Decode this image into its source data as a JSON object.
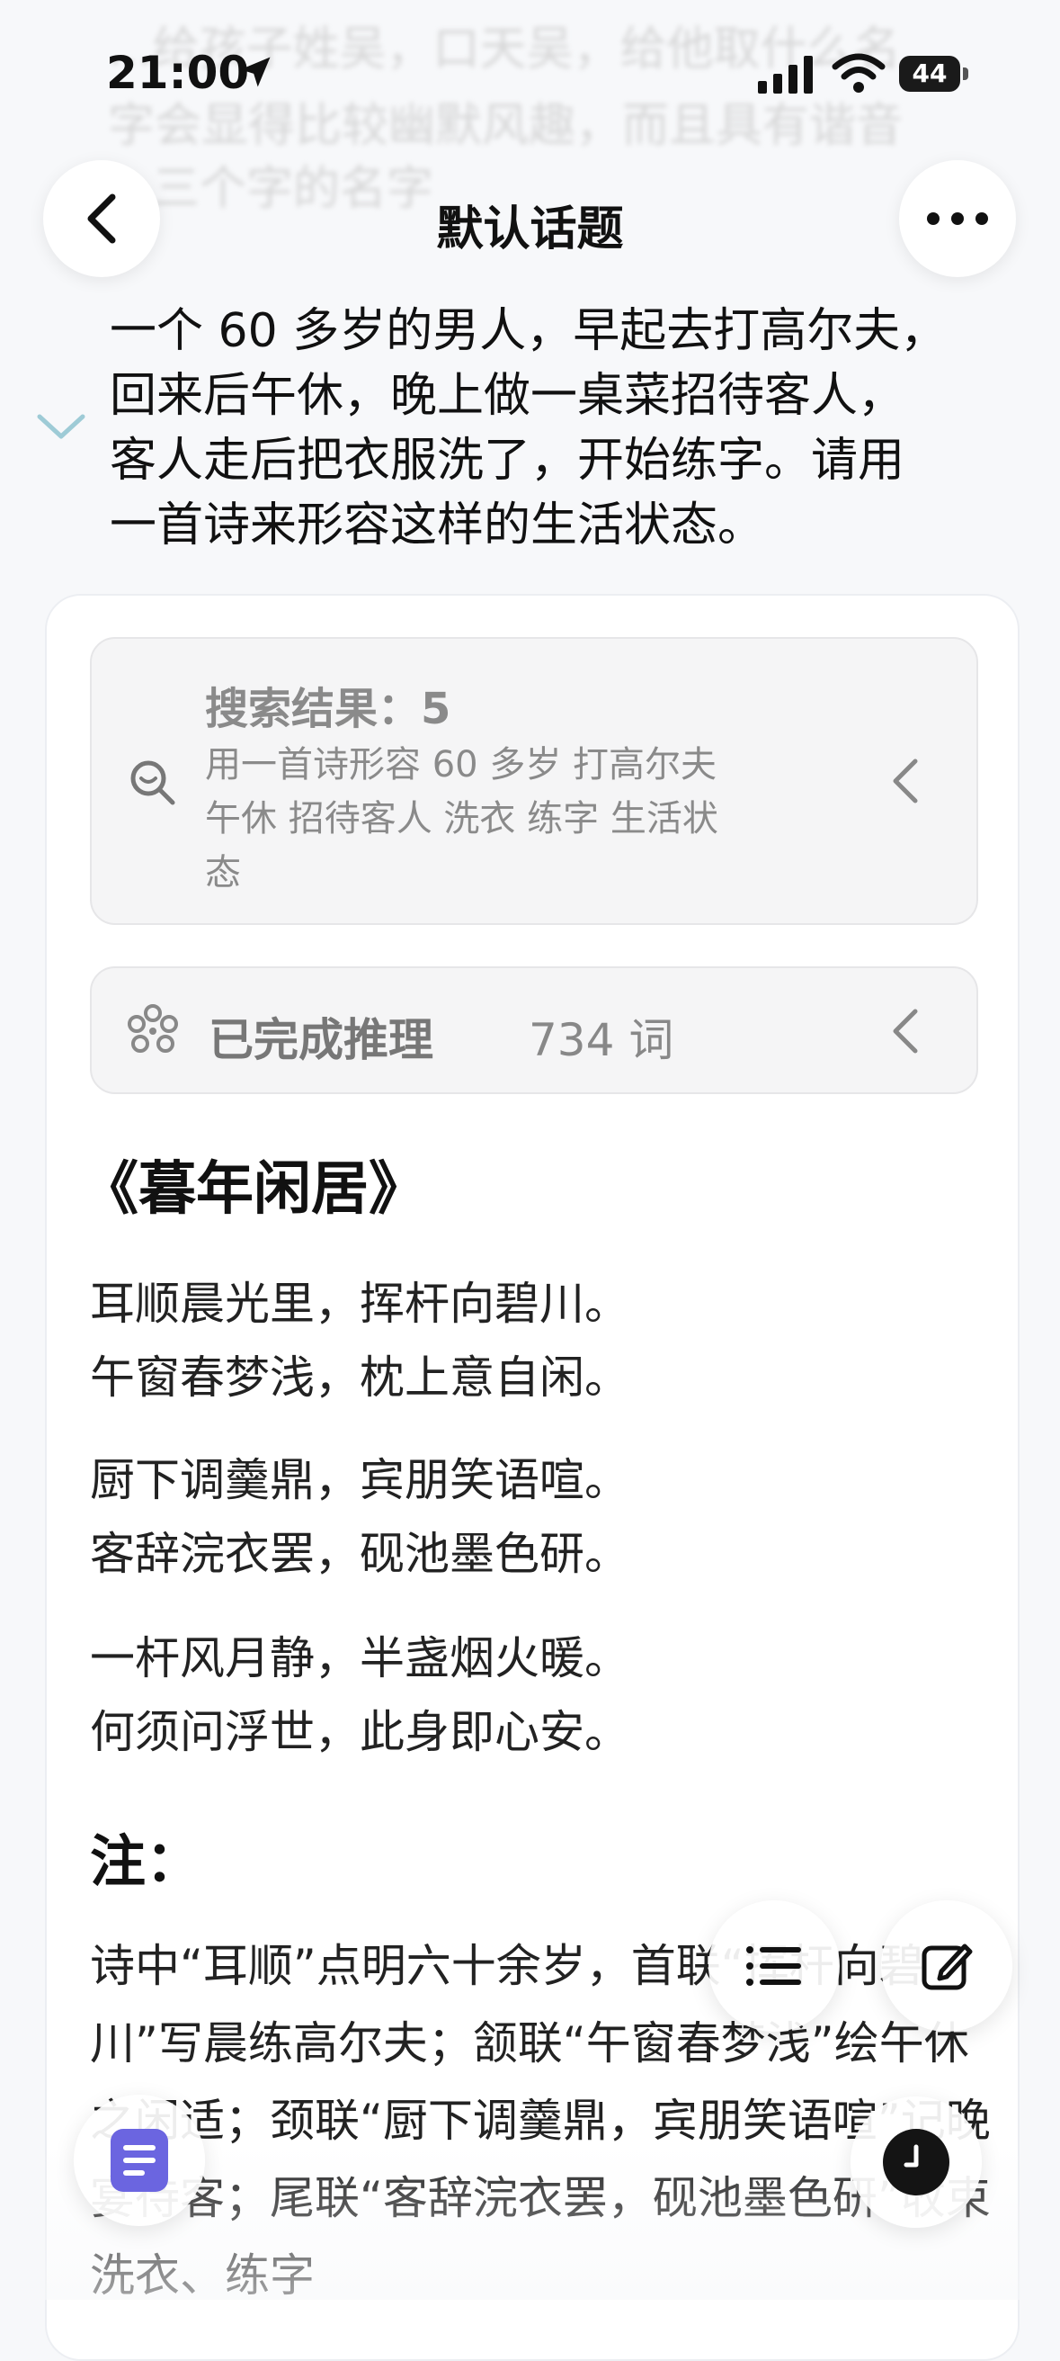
{
  "status_bar": {
    "time": "21:00",
    "battery": "44"
  },
  "nav": {
    "title": "默认话题"
  },
  "background_text": {
    "line1": "...给孩子姓吴，口天吴，给他取什么名",
    "line2": "字会显得比较幽默风趣，而且具有谐音",
    "line3": "三个字的名字"
  },
  "question": "一个 60 多岁的男人，早起去打高尔夫，\n回来后午休，晚上做一桌菜招待客人，\n客人走后把衣服洗了，开始练字。请用\n一首诗来形容这样的生活状态。",
  "search": {
    "title": "搜索结果：5",
    "query": "用一首诗形容 60 多岁 打高尔夫 午休 招待客人 洗衣 练字 生活状态"
  },
  "reasoning": {
    "label": "已完成推理",
    "count": "734  词"
  },
  "poem": {
    "title": "《暮年闲居》",
    "stanzas": [
      [
        "耳顺晨光里，挥杆向碧川。",
        "午窗春梦浅，枕上意自闲。"
      ],
      [
        "厨下调羹鼎，宾朋笑语喧。",
        "客辞浣衣罢，砚池墨色研。"
      ],
      [
        "一杆风月静，半盏烟火暖。",
        "何须问浮世，此身即心安。"
      ]
    ]
  },
  "note": {
    "title": "注：",
    "body": "诗中“耳顺”点明六十余岁，首联“挥杆向碧川”写晨练高尔夫；颔联“午窗春梦浅”绘午休之闲适；颈联“厨下调羹鼎，宾朋笑语喧”记晚宴待客；尾联“客辞浣衣罢，砚池墨色研”收束洗衣、练字"
  },
  "colors": {
    "accent": "#6b65e0",
    "background": "#f7f8fa"
  },
  "icons": [
    "back-icon",
    "more-icon",
    "location-arrow-icon",
    "signal-icon",
    "wifi-icon",
    "battery-icon",
    "search-icon",
    "reasoning-icon",
    "chevron-left-icon",
    "list-icon",
    "edit-icon",
    "document-icon",
    "clock-icon"
  ]
}
